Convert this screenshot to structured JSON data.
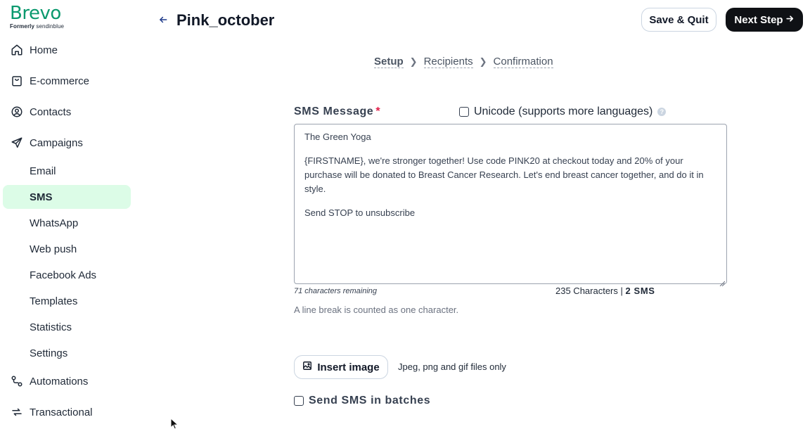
{
  "brand": {
    "logo_text": "Brevo",
    "formerly_label": "Formerly",
    "formerly_brand": "sendinblue",
    "brand_color": "#0b996e"
  },
  "sidebar": {
    "items": [
      {
        "label": "Home",
        "icon": "home-icon"
      },
      {
        "label": "E-commerce",
        "icon": "shopping-bag-icon"
      },
      {
        "label": "Contacts",
        "icon": "user-circle-icon"
      },
      {
        "label": "Campaigns",
        "icon": "paper-plane-icon"
      }
    ],
    "campaign_sub": [
      "Email",
      "SMS",
      "WhatsApp",
      "Web push",
      "Facebook Ads",
      "Templates",
      "Statistics",
      "Settings"
    ],
    "active_sub": "SMS",
    "active_color": "#dcfce7",
    "bottom_items": [
      {
        "label": "Automations",
        "icon": "automation-icon"
      },
      {
        "label": "Transactional",
        "icon": "refresh-icon"
      }
    ]
  },
  "header": {
    "title": "Pink_october",
    "save_label": "Save & Quit",
    "next_label": "Next Step"
  },
  "stepper": {
    "steps": [
      "Setup",
      "Recipients",
      "Confirmation"
    ],
    "current": "Setup"
  },
  "form": {
    "sms_label": "SMS Message",
    "required_mark": "*",
    "unicode_label": "Unicode (supports more languages)",
    "unicode_checked": false,
    "message": {
      "sender_line": "The Green Yoga",
      "body": "{FIRSTNAME}, we're stronger together! Use code PINK20 at checkout today and 20% of your purchase will be donated to Breast Cancer Research. Let's end breast cancer together, and do it in style.",
      "footer": "Send STOP to unsubscribe"
    },
    "remaining": "71 characters remaining",
    "char_count": "235 Characters",
    "sms_count": "2 SMS",
    "line_break_hint": "A line break is counted as one character.",
    "insert_image_label": "Insert image",
    "image_hint": "Jpeg, png and gif files only",
    "batches_label": "Send SMS in batches",
    "batches_checked": false
  }
}
